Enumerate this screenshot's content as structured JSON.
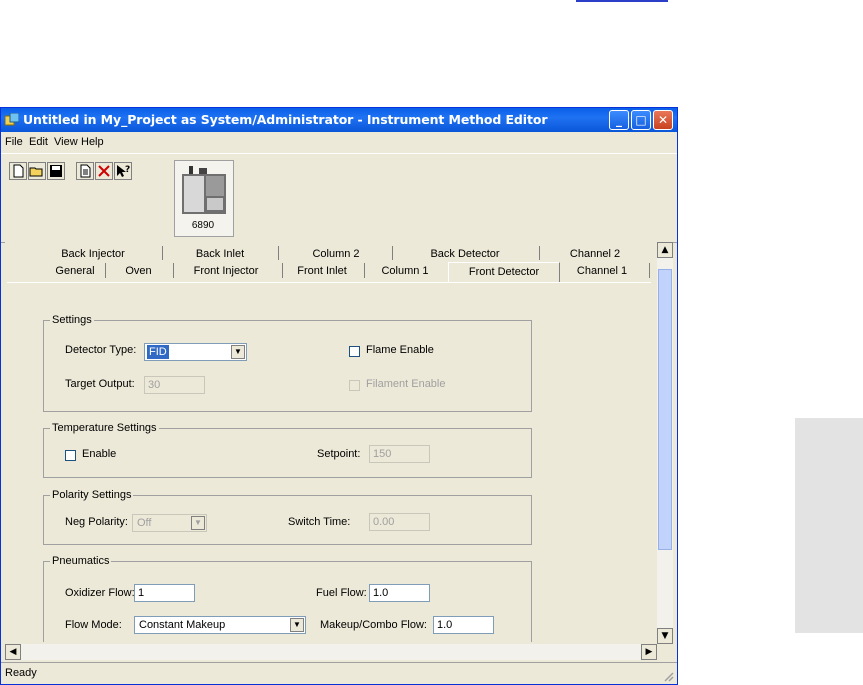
{
  "window": {
    "title": "Untitled in My_Project as System/Administrator - Instrument Method Editor",
    "buttons": {
      "minimize": "_",
      "maximize": "□",
      "close": "✕"
    }
  },
  "menu": [
    "File",
    "Edit",
    "View",
    "Help"
  ],
  "toolbar": {
    "icons": [
      "new-document-icon",
      "open-folder-icon",
      "save-icon",
      "properties-icon",
      "delete-icon",
      "context-help-icon"
    ],
    "instrument_label": "6890"
  },
  "tabs": {
    "back_row": [
      "Back Injector",
      "Back Inlet",
      "Column 2",
      "Back Detector",
      "Channel 2"
    ],
    "front_row": [
      "General",
      "Oven",
      "Front Injector",
      "Front Inlet",
      "Column 1",
      "Front Detector",
      "Channel 1"
    ],
    "active": "Front Detector"
  },
  "settings": {
    "group_title": "Settings",
    "detector_type_label": "Detector Type:",
    "detector_type_value": "FID",
    "flame_enable_label": "Flame Enable",
    "target_output_label": "Target Output:",
    "target_output_value": "30",
    "filament_enable_label": "Filament Enable"
  },
  "temperature": {
    "group_title": "Temperature Settings",
    "enable_label": "Enable",
    "setpoint_label": "Setpoint:",
    "setpoint_value": "150"
  },
  "polarity": {
    "group_title": "Polarity Settings",
    "neg_polarity_label": "Neg Polarity:",
    "neg_polarity_value": "Off",
    "switch_time_label": "Switch Time:",
    "switch_time_value": "0.00"
  },
  "pneumatics": {
    "group_title": "Pneumatics",
    "oxidizer_flow_label": "Oxidizer Flow:",
    "oxidizer_flow_value": "1",
    "fuel_flow_label": "Fuel Flow:",
    "fuel_flow_value": "1.0",
    "flow_mode_label": "Flow Mode:",
    "flow_mode_value": "Constant Makeup",
    "makeup_combo_flow_label": "Makeup/Combo Flow:",
    "makeup_combo_flow_value": "1.0"
  },
  "status": "Ready",
  "colors": {
    "titlebar": "#0a5fe8",
    "window_bg": "#ece9d8",
    "selection": "#316ac5"
  }
}
